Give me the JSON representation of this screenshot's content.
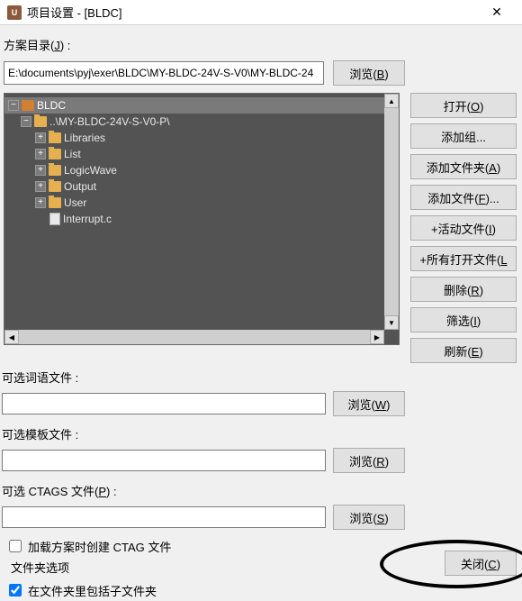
{
  "titlebar": {
    "title": "项目设置 - [BLDC]",
    "icon_text": "U"
  },
  "labels": {
    "scheme_dir": "方案目录(",
    "scheme_dir_key": "J",
    "scheme_dir_end": ") :",
    "opt_word_file": "可选词语文件 :",
    "opt_template_file": "可选模板文件 :",
    "opt_ctags_file_a": "可选 CTAGS 文件(",
    "opt_ctags_file_key": "P",
    "opt_ctags_file_b": ") :",
    "load_ctag": "加载方案时创建 CTAG 文件",
    "folder_options": "文件夹选项",
    "include_sub": "在文件夹里包括子文件夹"
  },
  "path": {
    "value": "E:\\documents\\pyj\\exer\\BLDC\\MY-BLDC-24V-S-V0\\MY-BLDC-24"
  },
  "browse": {
    "b": "浏览(B)",
    "w": "浏览(W)",
    "r": "浏览(R)",
    "s": "浏览(S)"
  },
  "side": {
    "open": "打开(O)",
    "add_group": "添加组...",
    "add_folder": "添加文件夹(A)",
    "add_file": "添加文件(F)...",
    "active_file": "+活动文件(I)",
    "all_open": "+所有打开文件(L",
    "delete": "删除(R)",
    "filter": "筛选(I)",
    "refresh": "刷新(E)"
  },
  "tree": {
    "root": "BLDC",
    "sub": "..\\MY-BLDC-24V-S-V0-P\\",
    "items": [
      "Libraries",
      "List",
      "LogicWave",
      "Output",
      "User"
    ],
    "file": "Interrupt.c"
  },
  "bottom": {
    "close": "关闭(C)"
  },
  "checks": {
    "load_ctag": false,
    "include_sub": true
  }
}
